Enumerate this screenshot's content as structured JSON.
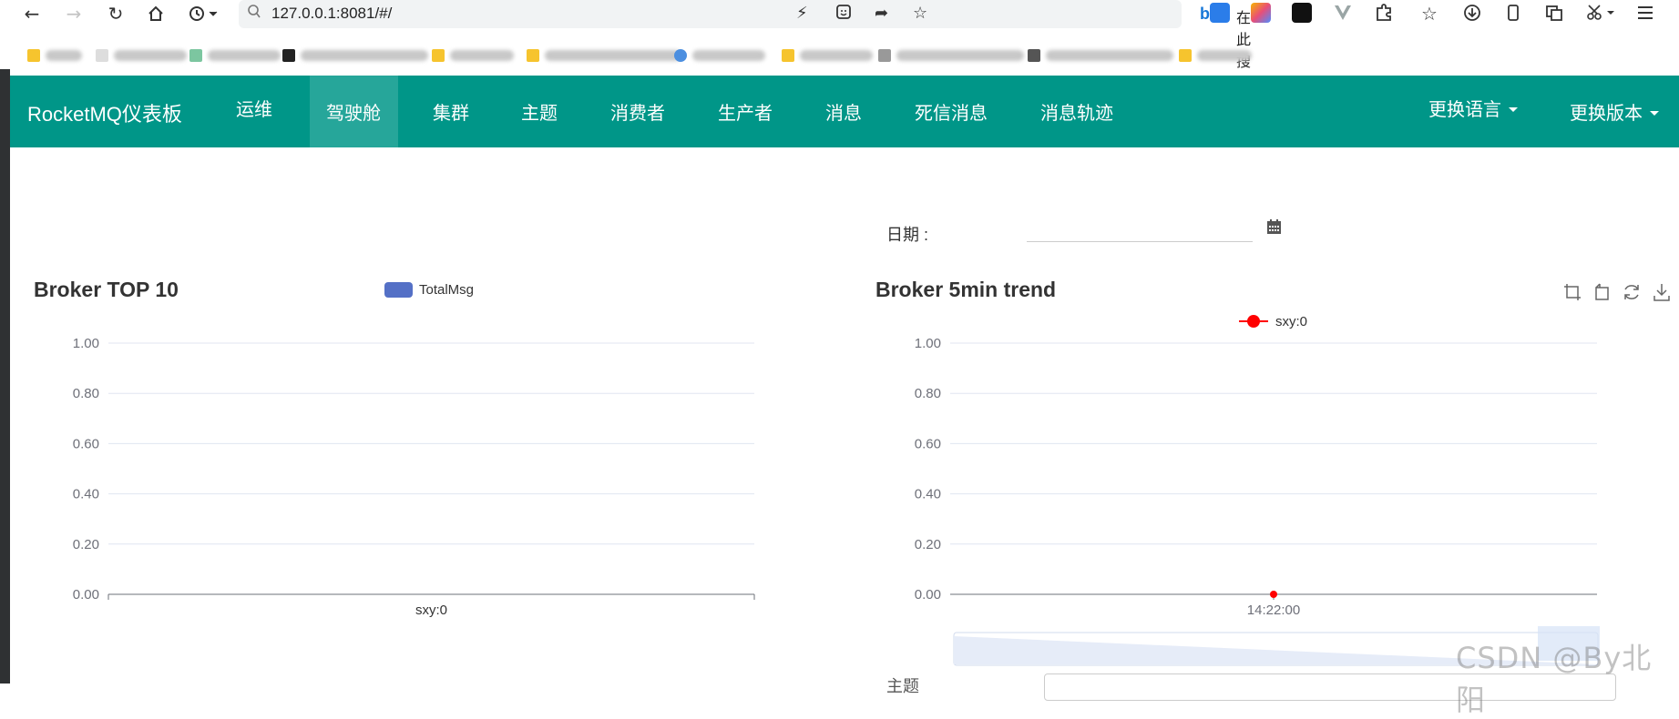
{
  "browser": {
    "url": "127.0.0.1:8081/#/",
    "search_placeholder": "在此搜索",
    "nav_icons": [
      "back-icon",
      "forward-icon",
      "reload-icon",
      "home-icon",
      "history-icon"
    ],
    "address_icons": [
      "lightning-icon",
      "reader-icon",
      "share-icon",
      "star-icon"
    ],
    "extension_icons": [
      "translate-icon",
      "ai-assistant-icon",
      "extension-app-icon",
      "vue-devtools-icon",
      "puzzle-icon",
      "favorites-icon",
      "download-icon",
      "mobile-icon",
      "tab-icon",
      "cut-icon",
      "menu-icon"
    ]
  },
  "navbar": {
    "brand": "RocketMQ仪表板",
    "items": [
      {
        "label": "运维",
        "active": false
      },
      {
        "label": "驾驶舱",
        "active": true
      },
      {
        "label": "集群",
        "active": false
      },
      {
        "label": "主题",
        "active": false
      },
      {
        "label": "消费者",
        "active": false
      },
      {
        "label": "生产者",
        "active": false
      },
      {
        "label": "消息",
        "active": false
      },
      {
        "label": "死信消息",
        "active": false
      },
      {
        "label": "消息轨迹",
        "active": false
      }
    ],
    "language_label": "更换语言",
    "version_label": "更换版本"
  },
  "date_filter": {
    "label": "日期 :",
    "value": "",
    "icon": "calendar-icon"
  },
  "bottom_partial": {
    "label": "主题"
  },
  "watermark": "CSDN @By北阳",
  "colors": {
    "navbar": "#009688",
    "navbar_active": "#26a69a",
    "bar_legend": "#5470c6",
    "line_series": "#ff0000",
    "gridline": "#e0e6f1"
  },
  "chart_data": [
    {
      "type": "bar",
      "title": "Broker TOP 10",
      "categories": [
        "sxy:0"
      ],
      "series": [
        {
          "name": "TotalMsg",
          "values": [
            0
          ]
        }
      ],
      "ylim": [
        0,
        1
      ],
      "yticks": [
        "0.00",
        "0.20",
        "0.40",
        "0.60",
        "0.80",
        "1.00"
      ],
      "legend": "top-center",
      "grid": true
    },
    {
      "type": "line",
      "title": "Broker 5min trend",
      "x": [
        "14:22:00"
      ],
      "series": [
        {
          "name": "sxy:0",
          "values": [
            0
          ]
        }
      ],
      "ylim": [
        0,
        1
      ],
      "yticks": [
        "0.00",
        "0.20",
        "0.40",
        "0.60",
        "0.80",
        "1.00"
      ],
      "legend": "top-center",
      "grid": true,
      "toolbox": [
        "zoom-icon",
        "zoom-reset-icon",
        "restore-icon",
        "save-image-icon"
      ]
    }
  ]
}
